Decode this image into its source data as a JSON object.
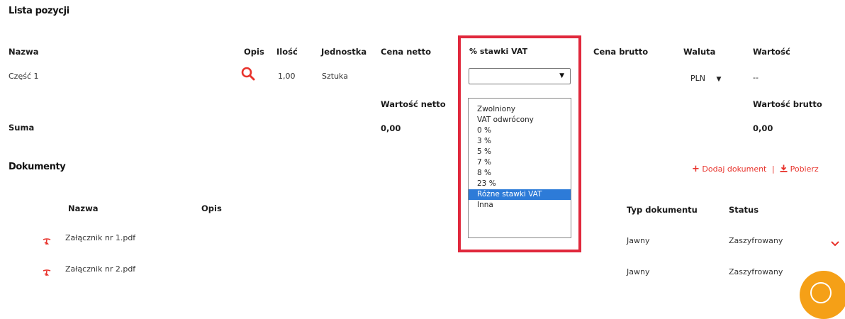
{
  "section_items": {
    "title": "Lista pozycji"
  },
  "items_table": {
    "headers": {
      "name": "Nazwa",
      "description": "Opis",
      "quantity": "Ilość",
      "unit": "Jednostka",
      "net_price": "Cena netto",
      "vat_rate": "% stawki VAT",
      "gross_price": "Cena brutto",
      "currency": "Waluta",
      "value": "Wartość"
    },
    "rows": [
      {
        "name": "Część 1",
        "description_icon": "search-icon",
        "quantity": "1,00",
        "unit": "Sztuka",
        "vat_rate_selected": "",
        "currency": "PLN",
        "value": "--"
      }
    ]
  },
  "vat_dropdown": {
    "options": [
      "Zwolniony",
      "VAT odwrócony",
      "0 %",
      "3 %",
      "5 %",
      "7 %",
      "8 %",
      "23 %",
      "Różne stawki VAT",
      "Inna"
    ],
    "highlighted_index": 8
  },
  "summary": {
    "label": "Suma",
    "net_label": "Wartość netto",
    "net_value": "0,00",
    "gross_label": "Wartość brutto",
    "gross_value": "0,00"
  },
  "documents": {
    "title": "Dokumenty",
    "add_label": "Dodaj dokument",
    "separator": "|",
    "download_label": "Pobierz",
    "headers": {
      "name": "Nazwa",
      "description": "Opis",
      "type": "Typ dokumentu",
      "status": "Status"
    },
    "rows": [
      {
        "name": "Załącznik nr 1.pdf",
        "type": "Jawny",
        "status": "Zaszyfrowany"
      },
      {
        "name": "Załącznik nr 2.pdf",
        "type": "Jawny",
        "status": "Zaszyfrowany"
      }
    ]
  },
  "colors": {
    "accent_red": "#e8332c",
    "highlight_blue": "#2d7bd8",
    "callout_red": "#e0283c",
    "fab_orange": "#f5a017"
  }
}
